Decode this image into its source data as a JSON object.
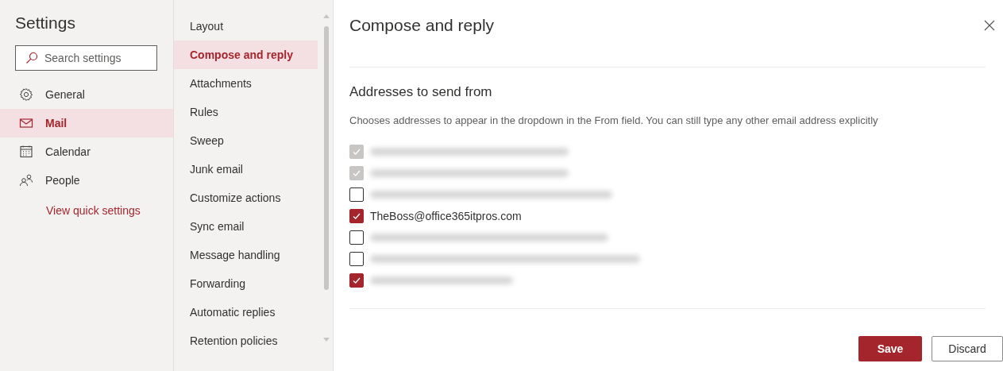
{
  "sidebar": {
    "title": "Settings",
    "search": {
      "placeholder": "Search settings"
    },
    "items": [
      {
        "label": "General",
        "kind": "gear",
        "selected": false
      },
      {
        "label": "Mail",
        "kind": "mail",
        "selected": true
      },
      {
        "label": "Calendar",
        "kind": "calendar",
        "selected": false
      },
      {
        "label": "People",
        "kind": "people",
        "selected": false
      }
    ],
    "link": "View quick settings"
  },
  "submenu": {
    "items": [
      {
        "label": "Layout",
        "selected": false
      },
      {
        "label": "Compose and reply",
        "selected": true
      },
      {
        "label": "Attachments",
        "selected": false
      },
      {
        "label": "Rules",
        "selected": false
      },
      {
        "label": "Sweep",
        "selected": false
      },
      {
        "label": "Junk email",
        "selected": false
      },
      {
        "label": "Customize actions",
        "selected": false
      },
      {
        "label": "Sync email",
        "selected": false
      },
      {
        "label": "Message handling",
        "selected": false
      },
      {
        "label": "Forwarding",
        "selected": false
      },
      {
        "label": "Automatic replies",
        "selected": false
      },
      {
        "label": "Retention policies",
        "selected": false
      }
    ]
  },
  "panel": {
    "title": "Compose and reply",
    "section": {
      "heading": "Addresses to send from",
      "description": "Chooses addresses to appear in the dropdown in the From field. You can still type any other email address explicitly",
      "addresses": [
        {
          "blurred": true,
          "checked": true,
          "disabled": true
        },
        {
          "blurred": true,
          "checked": true,
          "disabled": true
        },
        {
          "blurred": true,
          "checked": false,
          "disabled": false
        },
        {
          "blurred": false,
          "label": "TheBoss@office365itpros.com",
          "checked": true,
          "disabled": false
        },
        {
          "blurred": true,
          "checked": false,
          "disabled": false
        },
        {
          "blurred": true,
          "checked": false,
          "disabled": false
        },
        {
          "blurred": true,
          "checked": true,
          "disabled": false
        }
      ]
    },
    "buttons": [
      {
        "label": "Save",
        "kind": "primary"
      },
      {
        "label": "Discard",
        "kind": "secondary"
      }
    ]
  }
}
